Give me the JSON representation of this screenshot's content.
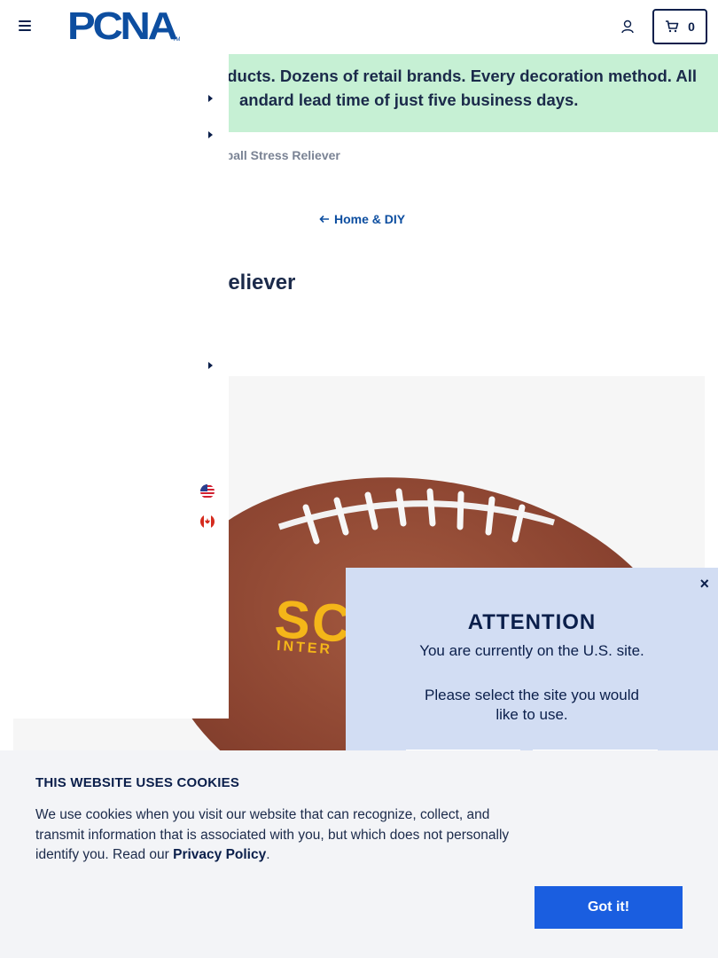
{
  "header": {
    "logo_text": "PCNA",
    "logo_tm": "TM",
    "cart_count": "0"
  },
  "banner": {
    "line1": "roducts. Dozens of retail brands. Every decoration method. All",
    "line2": "andard lead time of just five business days."
  },
  "breadcrumb": "tball Stress Reliever",
  "backlink": "Home & DIY",
  "title": "Reliever",
  "product": {
    "imprint": "SC",
    "imprint_sub": "INTER"
  },
  "attention": {
    "close": "×",
    "title": "ATTENTION",
    "message": "You are currently on the U.S. site.",
    "prompt": "Please select the site you would like to use."
  },
  "cookie": {
    "title": "THIS WEBSITE USES COOKIES",
    "text": "We use cookies when you visit our website that can recognize, collect, and transmit information that is associated with you, but which does not personally identify you. Read our",
    "link": "Privacy Policy",
    "period": ".",
    "button": "Got it!"
  },
  "colors": {
    "navy": "#0b1f4b",
    "brand_blue": "#0d4ea0",
    "banner_green": "#c6f0d4",
    "modal_blue": "#d2ddf3",
    "button_blue": "#1a5ee0"
  }
}
